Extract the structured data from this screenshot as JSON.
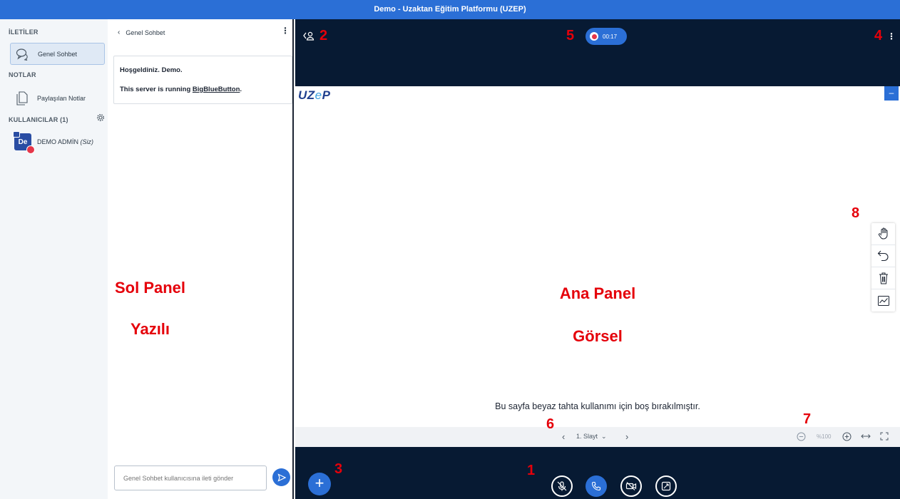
{
  "window": {
    "title": "Demo - Uzaktan Eğitim Platformu (UZEP)"
  },
  "sidebar": {
    "messages_title": "İLETİLER",
    "public_chat_label": "Genel Sohbet",
    "notes_title": "NOTLAR",
    "shared_notes_label": "Paylaşılan Notlar",
    "users_title": "KULLANICILAR (1)",
    "user": {
      "initials": "De",
      "name": "DEMO ADMİN",
      "you_tag": "(Siz)"
    }
  },
  "chat": {
    "header": "Genel Sohbet",
    "welcome_line": "Hoşgeldiniz. Demo.",
    "server_prefix": "This server is running ",
    "server_link": "BigBlueButton",
    "server_suffix": ".",
    "input_placeholder": "Genel Sohbet kullanıcısına ileti gönder"
  },
  "recording": {
    "time": "00:17"
  },
  "presentation": {
    "logo_main": "UZ",
    "logo_e": "e",
    "logo_end": "P",
    "minimize_label": "–",
    "blank_text": "Bu sayfa beyaz tahta kullanımı için boş bırakılmıştır.",
    "slide_label": "1. Slayt",
    "zoom": "%100"
  },
  "annotations": {
    "n1": "1",
    "n2": "2",
    "n3": "3",
    "n4": "4",
    "n5": "5",
    "n6": "6",
    "n7": "7",
    "n8": "8",
    "left_panel": "Sol Panel",
    "left_sub": "Yazılı",
    "main_panel": "Ana Panel",
    "main_sub": "Görsel"
  },
  "colors": {
    "accent": "#2b6fd6",
    "dark": "#071a33",
    "annotation": "#e5000a"
  }
}
